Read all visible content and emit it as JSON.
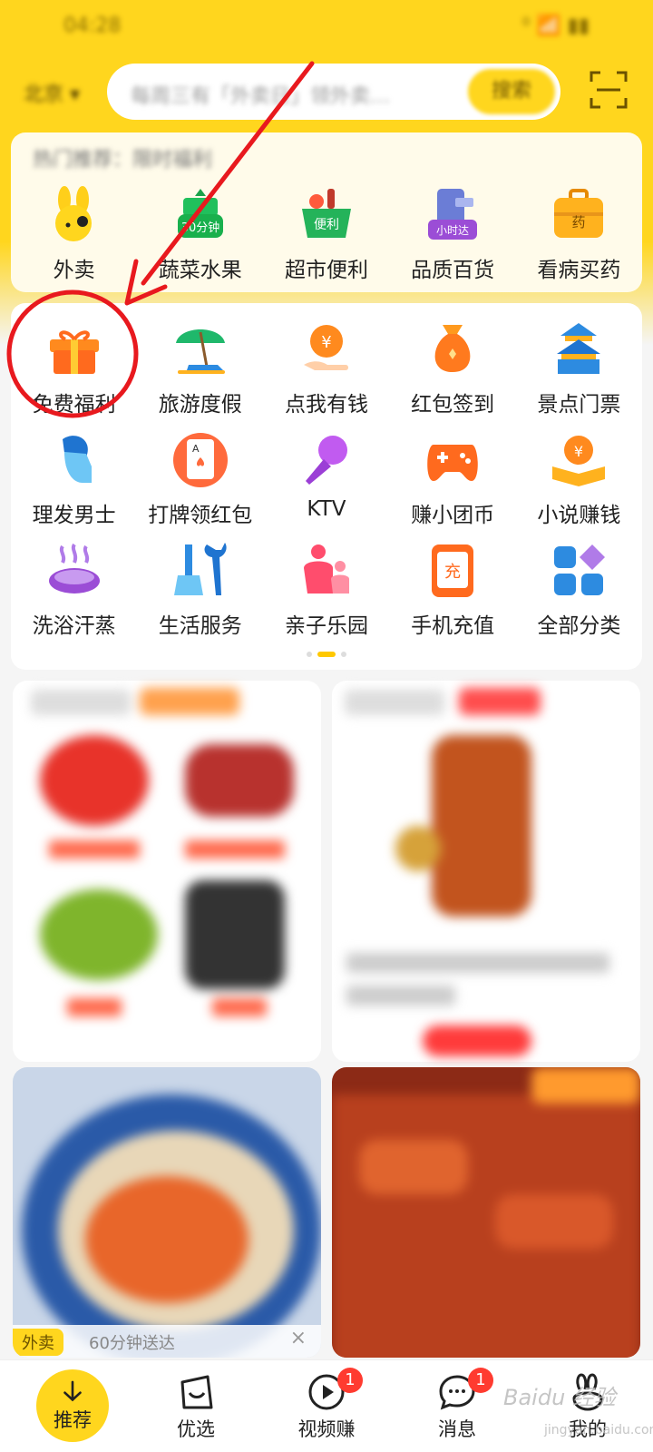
{
  "status": {
    "time": "04:28",
    "right": "⁰ 📶 ▮▮"
  },
  "header": {
    "city": "北京 ▾",
    "search_placeholder": "每周三有「外卖日」领外卖…",
    "search_button": "搜索"
  },
  "notice": "热门推荐：限时福利",
  "top_services": [
    {
      "label": "外卖",
      "icon": "rabbit-mascot-icon"
    },
    {
      "label": "蔬菜水果",
      "icon": "basket-30min-icon",
      "tag": "30分钟"
    },
    {
      "label": "超市便利",
      "icon": "grocery-basket-icon",
      "tag": "便利"
    },
    {
      "label": "品质百货",
      "icon": "phone-hourly-icon",
      "tag": "小时达"
    },
    {
      "label": "看病买药",
      "icon": "medicine-box-icon",
      "tag": "药"
    }
  ],
  "categories": [
    [
      {
        "label": "免费福利",
        "icon": "gift-icon"
      },
      {
        "label": "旅游度假",
        "icon": "beach-umbrella-icon"
      },
      {
        "label": "点我有钱",
        "icon": "coin-hand-icon"
      },
      {
        "label": "红包签到",
        "icon": "money-bag-icon"
      },
      {
        "label": "景点门票",
        "icon": "temple-icon"
      }
    ],
    [
      {
        "label": "理发男士",
        "icon": "barber-head-icon"
      },
      {
        "label": "打牌领红包",
        "icon": "playing-card-icon"
      },
      {
        "label": "KTV",
        "icon": "microphone-icon"
      },
      {
        "label": "赚小团币",
        "icon": "gamepad-icon"
      },
      {
        "label": "小说赚钱",
        "icon": "book-coin-icon"
      }
    ],
    [
      {
        "label": "洗浴汗蒸",
        "icon": "sauna-icon"
      },
      {
        "label": "生活服务",
        "icon": "tools-icon"
      },
      {
        "label": "亲子乐园",
        "icon": "parent-child-icon"
      },
      {
        "label": "手机充值",
        "icon": "phone-recharge-icon"
      },
      {
        "label": "全部分类",
        "icon": "all-categories-icon"
      }
    ]
  ],
  "category_tags": {
    "coin": "¥",
    "card": "A",
    "recharge": "充"
  },
  "feed": {
    "left_tag": "外卖",
    "left_caption": "60分钟送达",
    "close": "×"
  },
  "bottom_nav": [
    {
      "label": "推荐",
      "icon": "down-arrow-icon"
    },
    {
      "label": "优选",
      "icon": "bag-smile-icon"
    },
    {
      "label": "视频赚",
      "icon": "play-video-icon",
      "badge": "1"
    },
    {
      "label": "消息",
      "icon": "chat-bubble-icon",
      "badge": "1"
    },
    {
      "label": "我的",
      "icon": "rabbit-outline-icon"
    }
  ],
  "watermark": {
    "main": "Baidu 经验",
    "sub": "jingyan.baidu.com"
  },
  "colors": {
    "brand_yellow": "#ffd61e",
    "annotation_red": "#e8191e",
    "badge_red": "#ff3b30"
  }
}
